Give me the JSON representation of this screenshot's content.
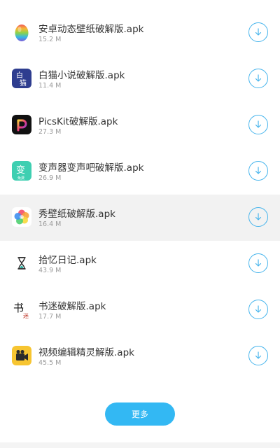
{
  "apps": [
    {
      "name": "安卓动态壁纸破解版.apk",
      "size": "15.2 M",
      "icon": "rainbow-egg-icon"
    },
    {
      "name": "白猫小说破解版.apk",
      "size": "11.4 M",
      "icon": "baimao-novel-icon",
      "icon_text": [
        "白",
        "猫"
      ]
    },
    {
      "name": "PicsKit破解版.apk",
      "size": "27.3 M",
      "icon": "picskit-icon"
    },
    {
      "name": "变声器变声吧破解版.apk",
      "size": "26.9 M",
      "icon": "voice-changer-icon",
      "icon_text": [
        "变",
        "免费"
      ]
    },
    {
      "name": "秀壁纸破解版.apk",
      "size": "16.4 M",
      "icon": "flower-wallpaper-icon"
    },
    {
      "name": "拾忆日记.apk",
      "size": "43.9 M",
      "icon": "hourglass-icon"
    },
    {
      "name": "书迷破解版.apk",
      "size": "17.7 M",
      "icon": "calligraphy-book-icon",
      "icon_text": [
        "书",
        "迷"
      ]
    },
    {
      "name": "视频编辑精灵解版.apk",
      "size": "45.5 M",
      "icon": "video-camera-icon"
    }
  ],
  "highlighted_index": 4,
  "more_button": {
    "label": "更多"
  },
  "colors": {
    "accent": "#33b8f3",
    "download_ring": "#46b4ec",
    "highlight": "#f2f2f2"
  }
}
